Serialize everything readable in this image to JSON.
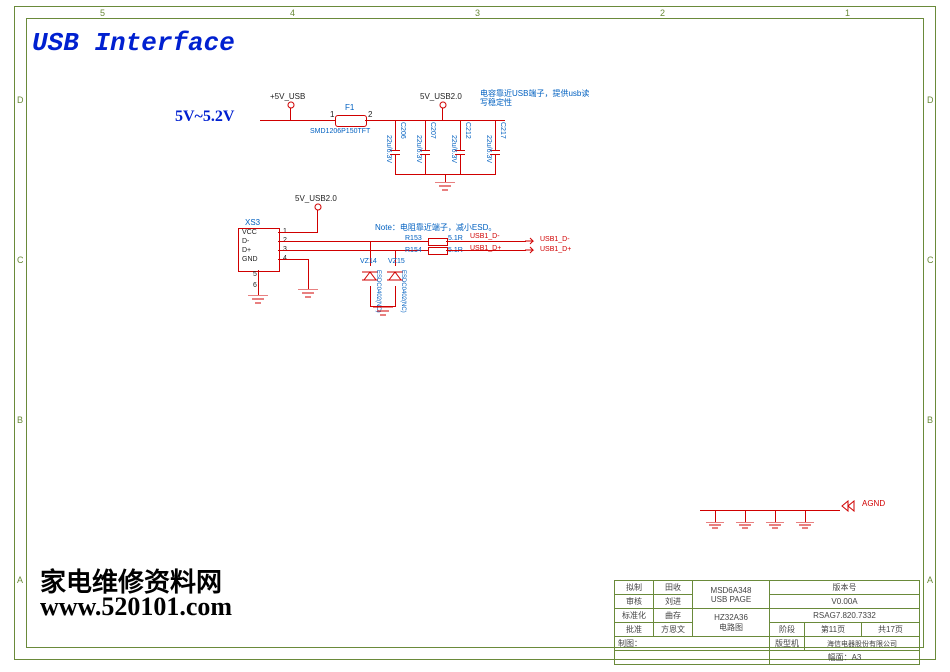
{
  "title": "USB Interface",
  "voltage_label": "5V~5.2V",
  "nets": {
    "p5v_usb": "+5V_USB",
    "p5v_usb20_a": "5V_USB2.0",
    "p5v_usb20_b": "5V_USB2.0",
    "usb1_dm": "USB1_D-",
    "usb1_dp": "USB1_D+",
    "usb1_dm_port": "USB1_D-",
    "usb1_dp_port": "USB1_D+",
    "agnd": "AGND"
  },
  "parts": {
    "f1": {
      "ref": "F1",
      "val": "SMD1206P150TFT"
    },
    "xs3": {
      "ref": "XS3",
      "pins": [
        "VCC",
        "D-",
        "D+",
        "GND"
      ]
    },
    "c206": {
      "ref": "C206",
      "val": "22u/6.3V"
    },
    "c207": {
      "ref": "C207",
      "val": "22u/6.3V"
    },
    "c212": {
      "ref": "C212",
      "val": "22u/6.3V"
    },
    "c217": {
      "ref": "C217",
      "val": "22u/6.3V"
    },
    "r153": {
      "ref": "R153",
      "val": "5.1R"
    },
    "r154": {
      "ref": "R154",
      "val": "5.1R"
    },
    "vz14": {
      "ref": "VZ14",
      "val": "ESDC0402(NC)"
    },
    "vz15": {
      "ref": "VZ15",
      "val": "ESDC0402(NC)"
    }
  },
  "notes": {
    "cap_note": "电容靠近USB端子，提供usb读写稳定性",
    "esd_note": "Note：电阻靠近端子，减小ESD。"
  },
  "pin_nums": {
    "p1": "1",
    "p2": "2",
    "p3": "3",
    "p4": "4",
    "p5": "5",
    "p6": "6"
  },
  "titleblock": {
    "r1c1": "拟制",
    "r1c2": "田收",
    "r2c1": "审核",
    "r2c2": "刘进",
    "r3c1": "标准化",
    "r3c2": "曲存",
    "r4c1": "批准",
    "r4c2": "方恩文",
    "proj1": "MSD6A348",
    "proj2": "USB PAGE",
    "proj3": "HZ32A36",
    "proj4": "电路图",
    "ver_h": "版本号",
    "ver": "V0.00A",
    "doc": "RSAG7.820.7332",
    "stage_h": "阶段",
    "page": "第11页",
    "pages": "共17页",
    "model_h": "版型机",
    "model": "海信电器股份有限公司",
    "size_h": "幅面：",
    "size": "A3",
    "draw": "制图："
  },
  "grid": {
    "top": [
      "5",
      "4",
      "3",
      "2",
      "1"
    ],
    "side": [
      "D",
      "C",
      "B",
      "A"
    ]
  },
  "watermark": {
    "cn": "家电维修资料网",
    "url": "www.520101.com"
  }
}
